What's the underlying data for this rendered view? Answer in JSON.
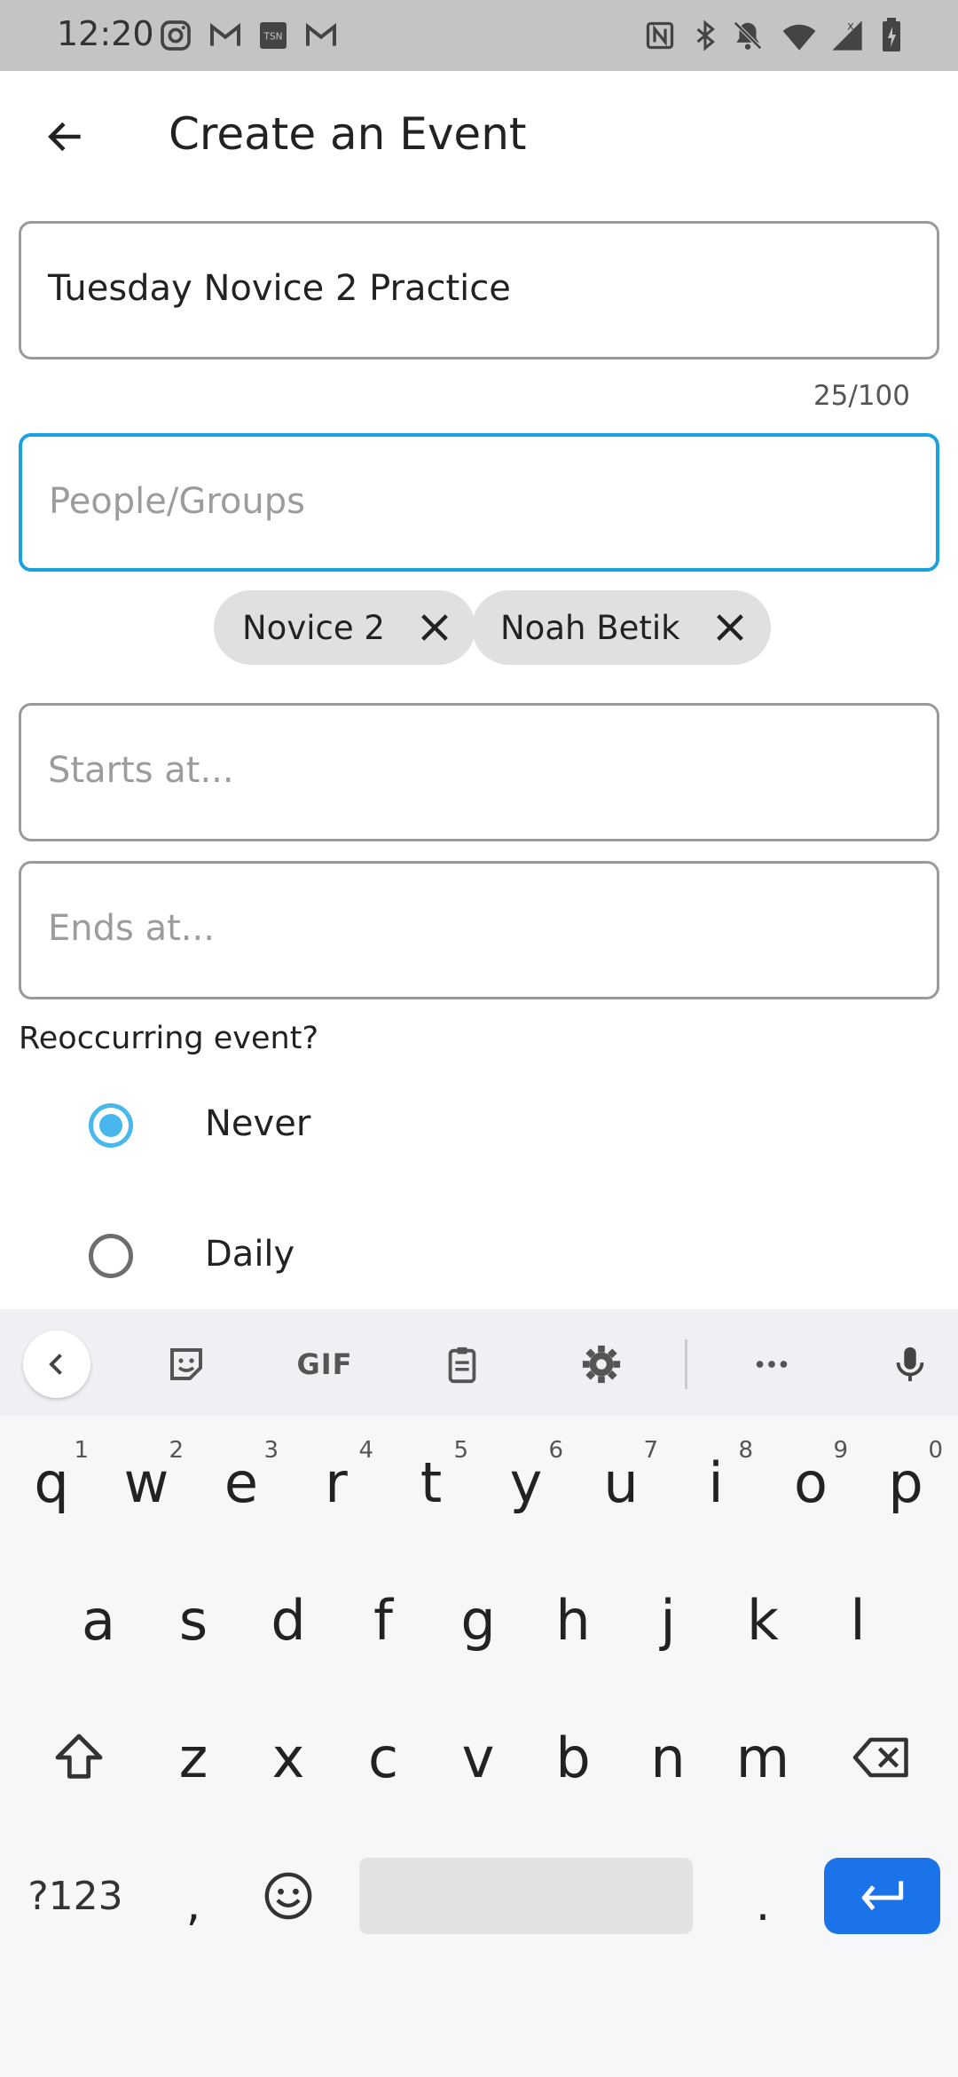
{
  "status_bar": {
    "time": "12:20",
    "left_icons": [
      "instagram-icon",
      "gmail-icon",
      "tsn-icon",
      "gmail-icon"
    ],
    "right_icons": [
      "nfc-icon",
      "bluetooth-icon",
      "mute-icon",
      "wifi-icon",
      "signal-icon",
      "battery-icon"
    ]
  },
  "app_bar": {
    "title": "Create an Event"
  },
  "form": {
    "event_name": {
      "value": "Tuesday Novice 2 Practice",
      "counter": "25/100"
    },
    "people": {
      "placeholder": "People/Groups",
      "chips": [
        "Novice 2",
        "Noah Betik"
      ]
    },
    "starts": {
      "placeholder": "Starts at..."
    },
    "ends": {
      "placeholder": "Ends at..."
    },
    "reoccur_label": "Reoccurring event?",
    "reoccur_options": [
      {
        "label": "Never",
        "selected": true
      },
      {
        "label": "Daily",
        "selected": false
      }
    ]
  },
  "keyboard": {
    "toolbar": {
      "gif_label": "GIF"
    },
    "row1": [
      "q",
      "w",
      "e",
      "r",
      "t",
      "y",
      "u",
      "i",
      "o",
      "p"
    ],
    "row1_hints": [
      "1",
      "2",
      "3",
      "4",
      "5",
      "6",
      "7",
      "8",
      "9",
      "0"
    ],
    "row2": [
      "a",
      "s",
      "d",
      "f",
      "g",
      "h",
      "j",
      "k",
      "l"
    ],
    "row3": [
      "z",
      "x",
      "c",
      "v",
      "b",
      "n",
      "m"
    ],
    "symbols_label": "?123",
    "comma": ",",
    "period": ".",
    "accent_color": "#1a73e8"
  },
  "colors": {
    "focus_border": "#1aa1e0",
    "radio_selected": "#47b7ee"
  }
}
